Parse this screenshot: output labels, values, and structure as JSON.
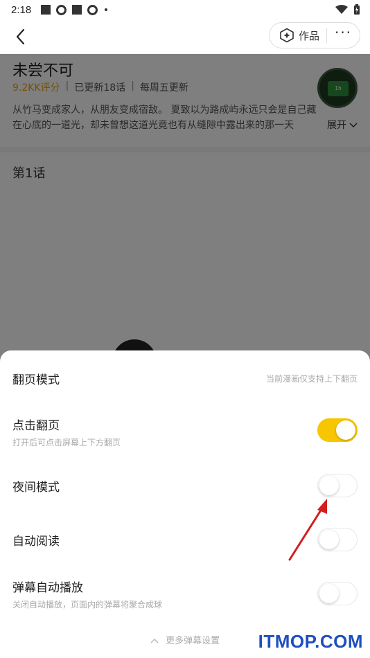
{
  "status_bar": {
    "time": "2:18"
  },
  "header": {
    "works_label": "作品",
    "more_label": "···"
  },
  "comic": {
    "title": "未尝不可",
    "rating": "9.2KK评分",
    "updated": "已更新18话",
    "schedule": "每周五更新",
    "desc_line1": "从竹马变成家人，从朋友变成宿敌。 夏致以为路成屿永远只会是自己藏",
    "desc_line2": "在心底的一道光，却未曾想这道光竟也有从缝隙中露出来的那一天",
    "expand_label": "展开",
    "avatar_text": "1h",
    "first_chapter": "第1话"
  },
  "settings": {
    "page_mode_label": "翻页模式",
    "page_mode_note": "当前漫画仅支持上下翻页",
    "tap_page_label": "点击翻页",
    "tap_page_sub": "打开后可点击屏幕上下方翻页",
    "tap_page_on": true,
    "night_mode_label": "夜间模式",
    "night_mode_on": false,
    "auto_read_label": "自动阅读",
    "auto_read_on": false,
    "danmaku_label": "弹幕自动播放",
    "danmaku_sub": "关闭自动播放，页面内的弹幕将聚合成球",
    "danmaku_on": false,
    "more_danmaku_label": "更多弹幕设置"
  },
  "colors": {
    "toggle_on": "#f7c600",
    "rating": "#e7a21a",
    "arrow": "#d11f1f",
    "watermark": "#1d4fbf"
  },
  "watermark": "ITMOP.COM"
}
